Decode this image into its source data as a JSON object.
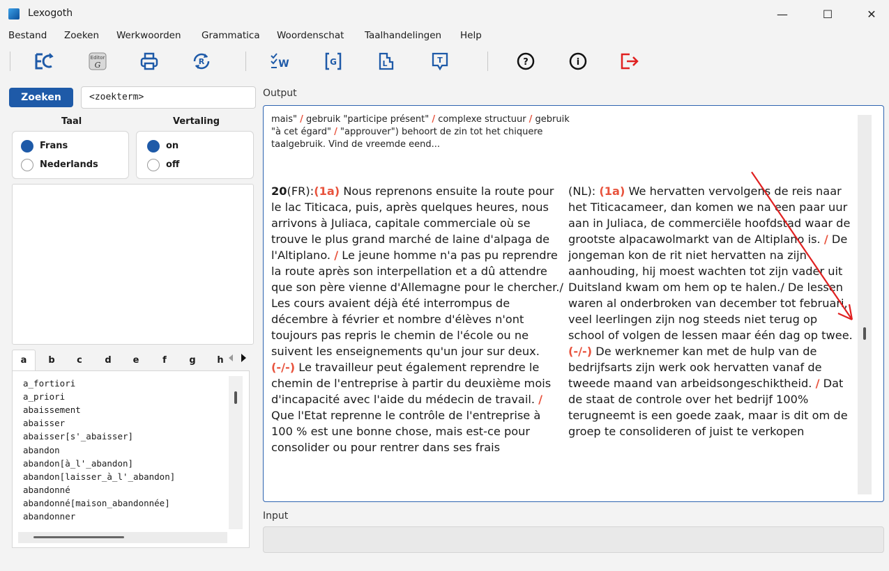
{
  "window": {
    "title": "Lexogoth",
    "minimize": "—",
    "maximize": "☐",
    "close": "✕"
  },
  "menu": [
    "Bestand",
    "Zoeken",
    "Werkwoorden",
    "Grammatica",
    "Woordenschat",
    "Taalhandelingen",
    "Help"
  ],
  "search": {
    "button": "Zoeken",
    "value": "<zoekterm>"
  },
  "taal": {
    "title": "Taal",
    "options": [
      "Frans",
      "Nederlands"
    ],
    "selected": "Frans"
  },
  "vertaling": {
    "title": "Vertaling",
    "options": [
      "on",
      "off"
    ],
    "selected": "on"
  },
  "tabs": [
    "a",
    "b",
    "c",
    "d",
    "e",
    "f",
    "g",
    "h"
  ],
  "words": [
    "a_fortiori",
    "a_priori",
    "abaissement",
    "abaisser",
    "abaisser[s'_abaisser]",
    "abandon",
    "abandon[à_l'_abandon]",
    "abandon[laisser_à_l'_abandon]",
    "abandonné",
    "abandonné[maison_abandonnée]",
    "abandonner"
  ],
  "output": {
    "label": "Output",
    "intro": [
      {
        "t": "mais\" "
      },
      {
        "r": "/"
      },
      {
        "t": " gebruik \"participe présent\" "
      },
      {
        "r": "/"
      },
      {
        "t": " complexe structuur "
      },
      {
        "r": "/"
      },
      {
        "t": " gebruik \"à cet égard\" "
      },
      {
        "r": "/"
      },
      {
        "t": " \"approuver\") behoort de zin tot het chiquere taalgebruik. Vind de vreemde eend..."
      }
    ],
    "fr": [
      {
        "b": "20"
      },
      {
        "t": "(FR):"
      },
      {
        "r": "(1a)"
      },
      {
        "t": " Nous reprenons ensuite la route pour le lac Titicaca, puis, après quelques heures, nous arrivons à Juliaca, capitale commerciale où se trouve le plus grand marché de laine d'alpaga de l'Altiplano. "
      },
      {
        "r": "/"
      },
      {
        "t": " Le jeune homme n'a pas pu reprendre la route après son interpellation et a dû attendre que son père vienne d'Allemagne pour le chercher./ Les cours avaient déjà été interrompus de décembre à février et nombre d'élèves n'ont toujours pas repris le chemin de l'école ou ne suivent les enseignements qu'un jour sur deux. "
      },
      {
        "r": "(-/-)"
      },
      {
        "t": " Le travailleur peut également reprendre le chemin de l'entreprise à partir du deuxième mois d'incapacité avec l'aide du médecin de travail. "
      },
      {
        "r": "/"
      },
      {
        "t": " Que l'Etat reprenne le contrôle de l'entreprise à 100 % est une bonne chose, mais est-ce pour consolider ou pour rentrer dans ses frais"
      }
    ],
    "nl": [
      {
        "t": "(NL): "
      },
      {
        "r": "(1a)"
      },
      {
        "t": " We hervatten vervolgens de reis naar het Titicacameer, dan komen we na een paar uur aan in Juliaca, de commerciële hoofdstad waar de grootste alpacawolmarkt van de Altiplano is. "
      },
      {
        "r": "/"
      },
      {
        "t": " De jongeman kon de rit niet hervatten na zijn aanhouding, hij moest wachten tot zijn vader uit Duitsland kwam om hem op te halen./ De lessen waren al onderbroken van december tot februari, veel leerlingen zijn nog steeds niet terug op school of volgen de lessen maar één dag op twee. "
      },
      {
        "r": "(-/-)"
      },
      {
        "t": " De werknemer kan met de hulp van de bedrijfsarts zijn werk ook hervatten vanaf de tweede maand van arbeidsongeschiktheid. "
      },
      {
        "r": "/"
      },
      {
        "t": " Dat de staat de controle over het bedrijf 100% terugneemt is een goede zaak, maar is dit om de groep te consolideren of juist te verkopen"
      }
    ]
  },
  "input": {
    "label": "Input"
  },
  "colors": {
    "accent": "#1e5aa8",
    "marker": "#e8533d",
    "annotation": "#e02020"
  }
}
